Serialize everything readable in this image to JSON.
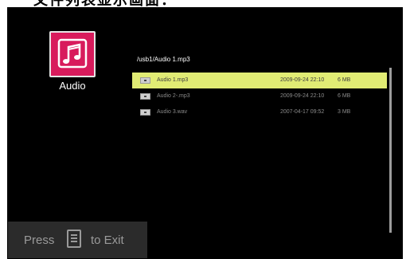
{
  "caption": {
    "text": "文件列表显示画面："
  },
  "sidebar": {
    "icon": "music-note-icon",
    "label": "Audio",
    "icon_color": "#d81b5c"
  },
  "path": "/usb1/Audio 1.mp3",
  "files": [
    {
      "name": "Audio 1.mp3",
      "date": "2009-09-24 22:10",
      "size": "6 MB",
      "selected": true
    },
    {
      "name": "Audio 2-.mp3",
      "date": "2009-09-24 22:10",
      "size": "6 MB",
      "selected": false
    },
    {
      "name": "Audio 3.wav",
      "date": "2007-04-17 09:52",
      "size": "3 MB",
      "selected": false
    }
  ],
  "colors": {
    "selection": "#e1ec74",
    "screen": "#000000",
    "exit_bar": "#2b2b2b"
  },
  "exit_hint": {
    "press": "Press",
    "icon": "menu-icon",
    "to_exit": "to Exit"
  }
}
